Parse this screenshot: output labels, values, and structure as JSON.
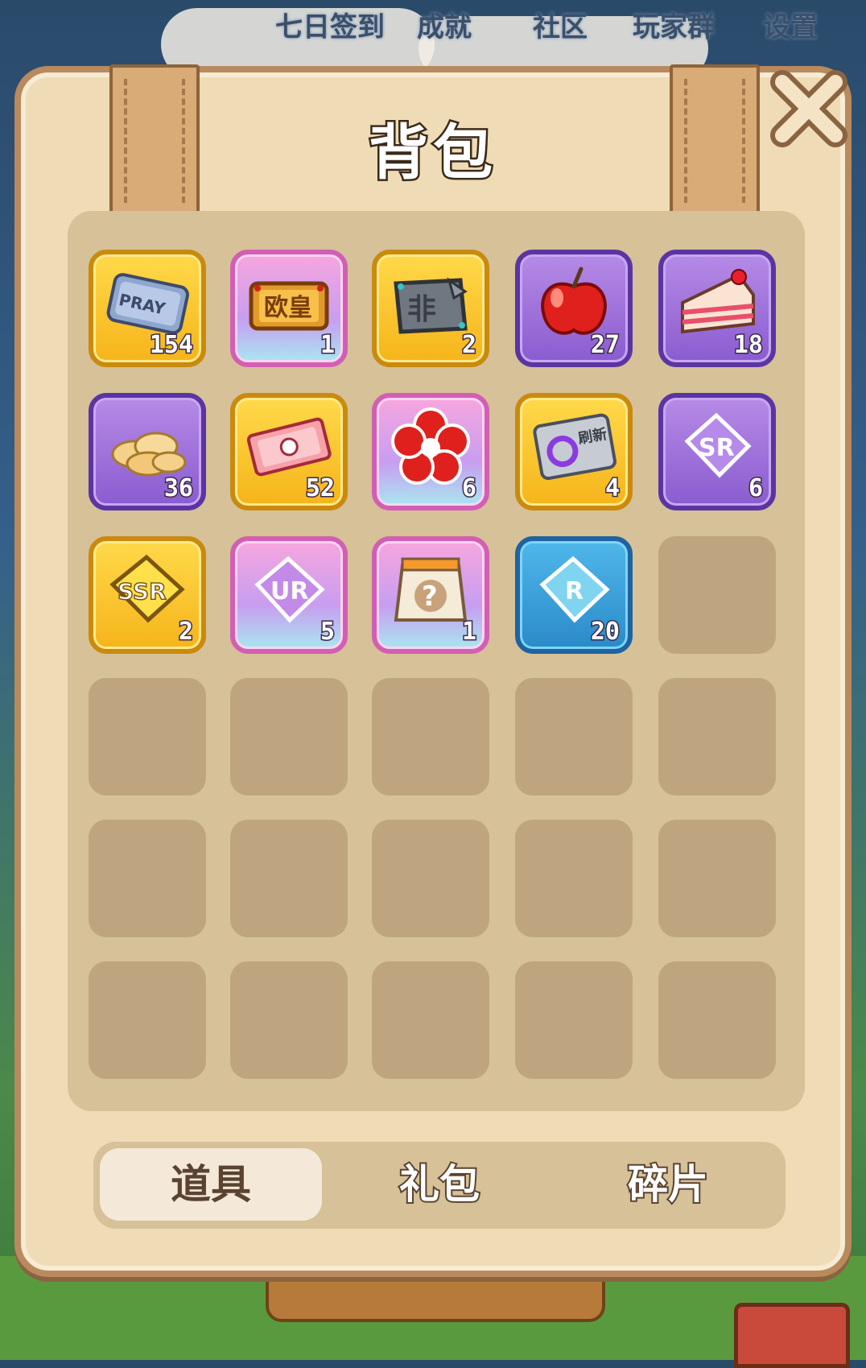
{
  "top_nav": {
    "items": [
      {
        "label": "七日签到"
      },
      {
        "label": "成就"
      },
      {
        "label": "社区"
      },
      {
        "label": "玩家群"
      },
      {
        "label": "设置"
      }
    ]
  },
  "bag": {
    "title": "背包",
    "close_icon": "close-icon",
    "items": [
      {
        "icon": "pray-ticket-icon",
        "frame": "gold",
        "count": "154"
      },
      {
        "icon": "ouhuang-plaque-icon",
        "frame": "pink",
        "count": "1"
      },
      {
        "icon": "fei-stone-plaque-icon",
        "frame": "gold",
        "count": "2"
      },
      {
        "icon": "apple-icon",
        "frame": "purple",
        "count": "27"
      },
      {
        "icon": "cake-slice-icon",
        "frame": "purple",
        "count": "18"
      },
      {
        "icon": "potato-chips-icon",
        "frame": "purple",
        "count": "36"
      },
      {
        "icon": "pink-ticket-icon",
        "frame": "gold",
        "count": "52"
      },
      {
        "icon": "plum-blossom-icon",
        "frame": "pink",
        "count": "6"
      },
      {
        "icon": "refresh-card-icon",
        "frame": "gold",
        "count": "4",
        "label": "刷新"
      },
      {
        "icon": "sr-puzzle-piece-icon",
        "frame": "purple",
        "count": "6",
        "label": "SR"
      },
      {
        "icon": "ssr-puzzle-piece-icon",
        "frame": "gold",
        "count": "2",
        "label": "SSR"
      },
      {
        "icon": "ur-puzzle-piece-icon",
        "frame": "pink",
        "count": "5",
        "label": "UR"
      },
      {
        "icon": "mystery-bag-icon",
        "frame": "pink",
        "count": "1"
      },
      {
        "icon": "r-puzzle-piece-icon",
        "frame": "blue",
        "count": "20",
        "label": "R"
      }
    ],
    "empty_slot_count": 16,
    "item_labels": {
      "pray": "PRAY",
      "ouhuang": "欧皇",
      "fei": "非",
      "refresh": "刷新",
      "sr": "SR",
      "ssr": "SSR",
      "ur": "UR",
      "r": "R"
    }
  },
  "tabs": [
    {
      "label": "道具",
      "active": true
    },
    {
      "label": "礼包",
      "active": false
    },
    {
      "label": "碎片",
      "active": false
    }
  ],
  "colors": {
    "panel_bg": "#efdbb5",
    "panel_border": "#b98a5e",
    "grid_bg": "#d6c198",
    "empty_slot": "#bea57f",
    "active_tab_bg": "#f4e9d8"
  }
}
